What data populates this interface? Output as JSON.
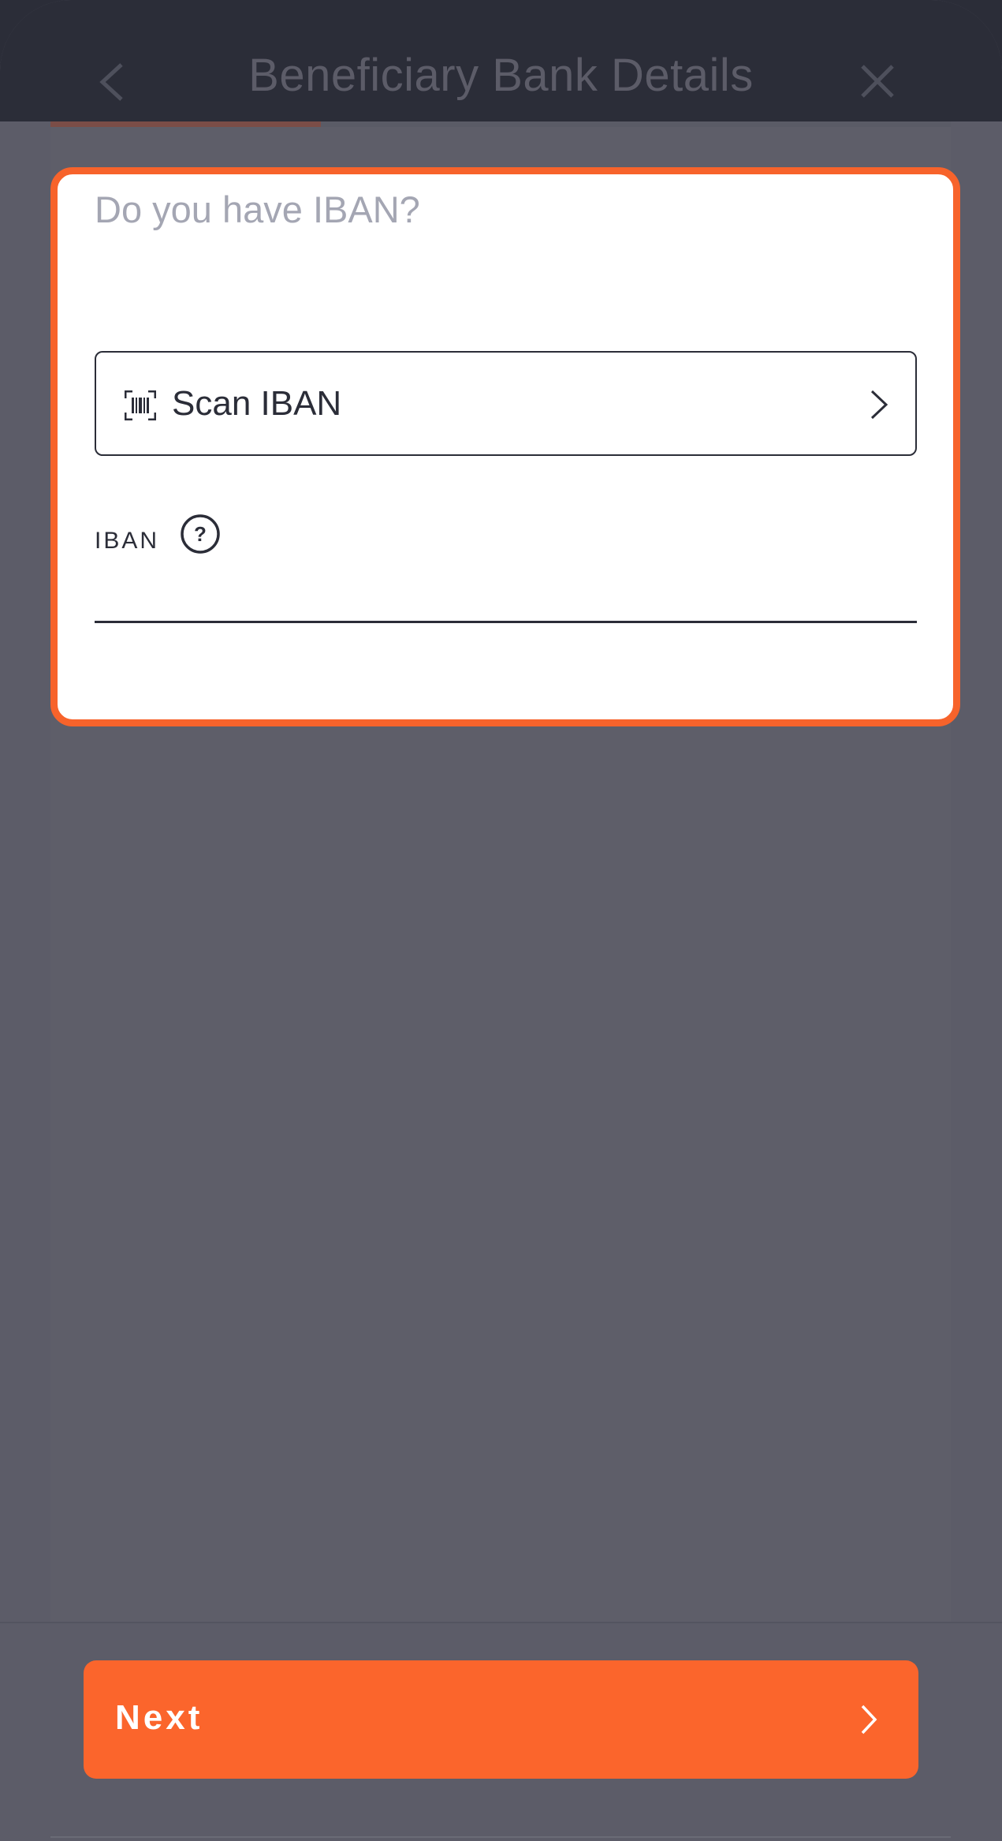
{
  "header": {
    "title": "Beneficiary Bank Details",
    "back_icon": "chevron-left-icon",
    "close_icon": "close-icon"
  },
  "progress": {
    "fraction": 0.3
  },
  "form": {
    "question": "Do you have IBAN?",
    "scan_button_label": "Scan IBAN",
    "scan_icon": "barcode-scan-icon",
    "iban_label": "IBAN",
    "iban_value": "",
    "help_icon": "question-circle-icon"
  },
  "footer": {
    "next_label": "Next"
  },
  "colors": {
    "accent": "#f7632b",
    "header_bg": "#2b2d38",
    "overlay_bg": "#5c5c68"
  }
}
